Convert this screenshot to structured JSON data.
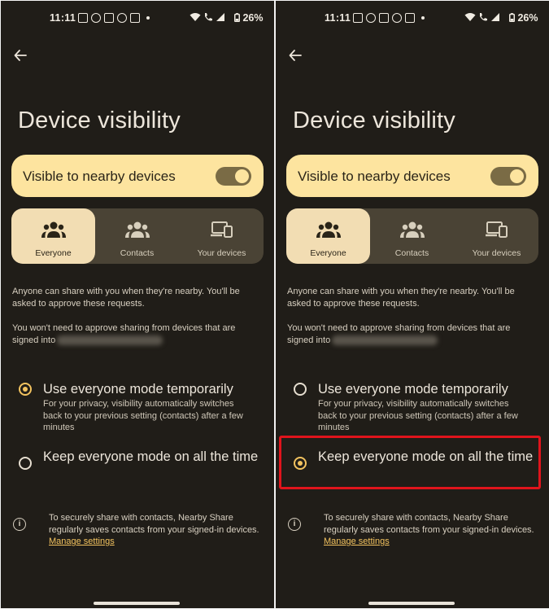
{
  "status": {
    "time": "11:11",
    "battery": "26%"
  },
  "screen": {
    "title": "Device visibility",
    "visibility": {
      "label": "Visible to nearby devices",
      "enabled": true
    },
    "segments": [
      {
        "label": "Everyone",
        "icon": "people-group-icon"
      },
      {
        "label": "Contacts",
        "icon": "contacts-group-icon"
      },
      {
        "label": "Your devices",
        "icon": "devices-icon"
      }
    ],
    "description": {
      "line1": "Anyone can share with you when they're nearby. You'll be asked to approve these requests.",
      "line2_prefix": "You won't need to approve sharing from devices that are signed into"
    },
    "options": {
      "temporary": {
        "title": "Use everyone mode temporarily",
        "subtitle": "For your privacy, visibility automatically switches back to your previous setting (contacts) after a few minutes"
      },
      "always": {
        "title": "Keep everyone mode on all the time"
      }
    },
    "info": {
      "text": "To securely share with contacts, Nearby Share regularly saves contacts from your signed-in devices.",
      "link": "Manage settings"
    }
  },
  "panels": [
    {
      "selected_option": "temporary"
    },
    {
      "selected_option": "always",
      "highlighted": true
    }
  ],
  "colors": {
    "background": "#201d18",
    "accent": "#f3c35f",
    "card": "#fde49f",
    "highlight": "#e0141c"
  }
}
